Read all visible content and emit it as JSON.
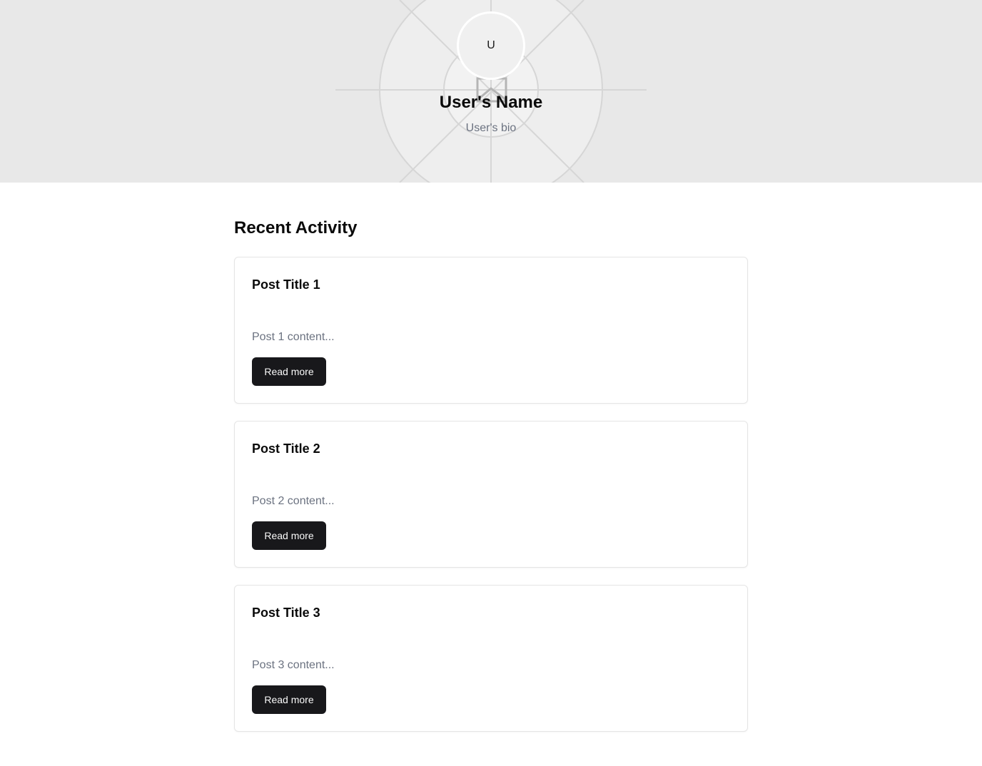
{
  "profile": {
    "avatar_initial": "U",
    "name": "User's Name",
    "bio": "User's bio"
  },
  "activity": {
    "title": "Recent Activity",
    "posts": [
      {
        "title": "Post Title 1",
        "content": "Post 1 content...",
        "button_label": "Read more"
      },
      {
        "title": "Post Title 2",
        "content": "Post 2 content...",
        "button_label": "Read more"
      },
      {
        "title": "Post Title 3",
        "content": "Post 3 content...",
        "button_label": "Read more"
      }
    ]
  },
  "icons": {
    "banner_placeholder": "image-placeholder-icon"
  },
  "colors": {
    "banner_bg": "#e8e8e8",
    "button_bg": "#18181b",
    "muted_text": "#6b7280",
    "card_border": "#e5e5e5"
  }
}
